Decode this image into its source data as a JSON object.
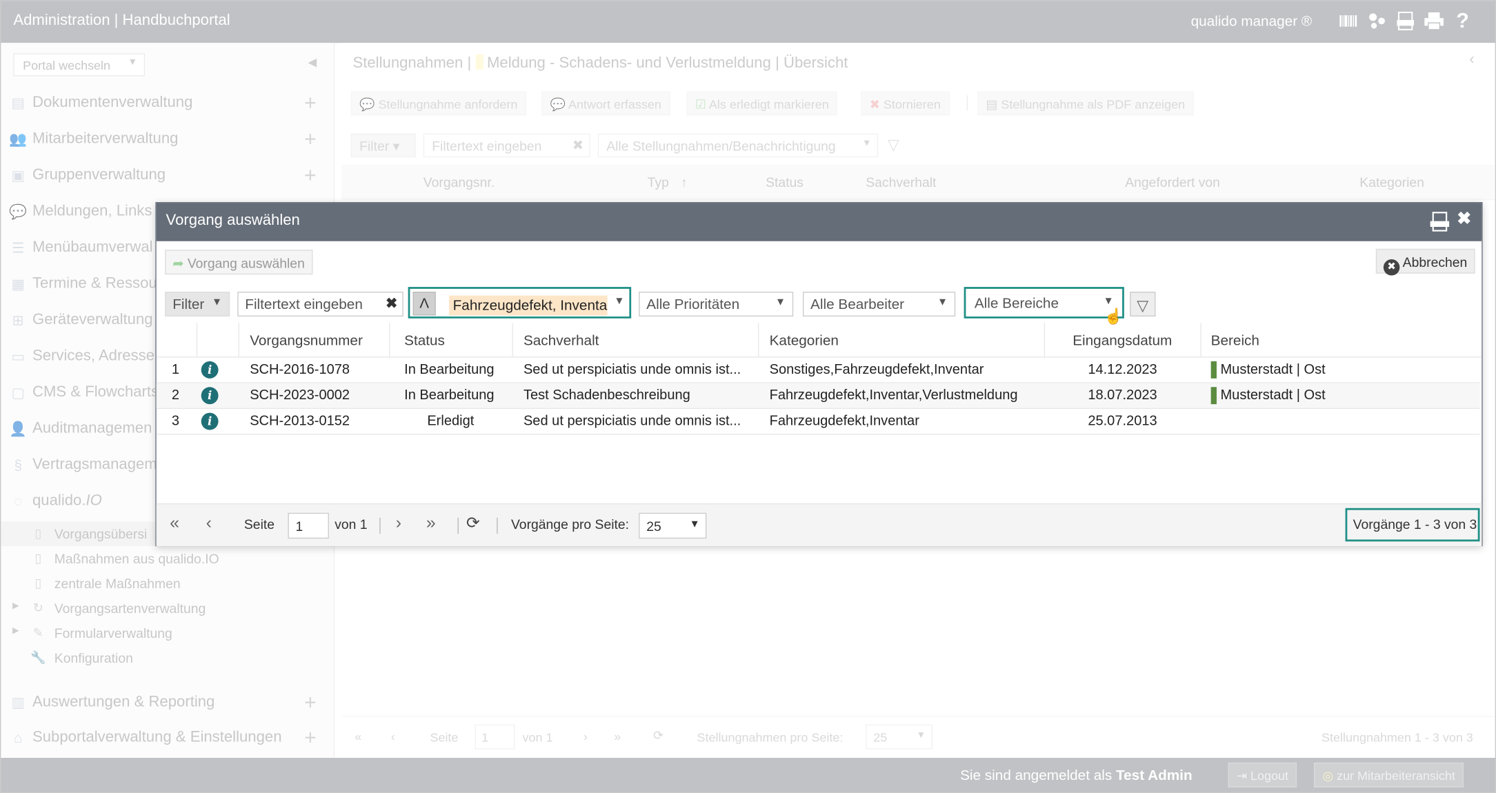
{
  "topbar": {
    "title": "Administration | Handbuchportal",
    "brand": "qualido manager ®",
    "icons": [
      "barcode-icon",
      "network-icon",
      "xls-icon",
      "print-icon",
      "help-icon"
    ]
  },
  "sidebar": {
    "portal_select": "Portal wechseln",
    "items": [
      {
        "label": "Dokumentenverwaltung",
        "icon": "documents-icon",
        "plus": "+"
      },
      {
        "label": "Mitarbeiterverwaltung",
        "icon": "users-icon",
        "plus": "+"
      },
      {
        "label": "Gruppenverwaltung",
        "icon": "groups-icon",
        "plus": "+"
      },
      {
        "label": "Meldungen, Links",
        "icon": "chat-icon"
      },
      {
        "label": "Menübaumverwal",
        "icon": "list-icon"
      },
      {
        "label": "Termine & Ressou",
        "icon": "calendar-icon"
      },
      {
        "label": "Geräteverwaltung",
        "icon": "device-icon"
      },
      {
        "label": "Services, Adressen",
        "icon": "address-icon"
      },
      {
        "label": "CMS & Flowcharts",
        "icon": "cms-icon"
      },
      {
        "label": "Auditmanagemen",
        "icon": "audit-icon"
      },
      {
        "label": "Vertragsmanagem",
        "icon": "paragraph-icon"
      },
      {
        "label": "qualido.",
        "label_em": "IO",
        "icon": "qualido-icon"
      }
    ],
    "subitems": [
      {
        "label": "Vorgangsübersi",
        "icon": "doc-icon"
      },
      {
        "label": "Maßnahmen aus qualido.IO",
        "icon": "doc-icon"
      },
      {
        "label": "zentrale Maßnahmen",
        "icon": "doc-icon"
      },
      {
        "label": "Vorgangsartenverwaltung",
        "icon": "cycle-icon",
        "expandable": true
      },
      {
        "label": "Formularverwaltung",
        "icon": "form-icon",
        "expandable": true
      },
      {
        "label": "Konfiguration",
        "icon": "wrench-icon"
      }
    ],
    "bottom_items": [
      {
        "label": "Auswertungen & Reporting",
        "icon": "chart-icon",
        "plus": "+"
      },
      {
        "label": "Subportalverwaltung & Einstellungen",
        "icon": "home-icon",
        "plus": "+"
      }
    ]
  },
  "main": {
    "breadcrumb": {
      "part1": "Stellungnahmen",
      "sep": "|",
      "part2": "Meldung - Schadens- und Verlustmeldung",
      "sep2": "|",
      "part3": "Übersicht"
    },
    "toolbar": [
      "Stellungnahme anfordern",
      "Antwort erfassen",
      "Als erledigt markieren",
      "Stornieren",
      "Stellungnahme als PDF anzeigen"
    ],
    "filter_label": "Filter",
    "filter_text": "Filtertext eingeben",
    "filter_select": "Alle Stellungnahmen/Benachrichtigung",
    "columns": [
      "Vorgangsnr.",
      "Typ",
      "Status",
      "Sachverhalt",
      "Angefordert von",
      "Kategorien"
    ],
    "pager": {
      "page_label": "Seite",
      "page": "1",
      "of": "von 1",
      "per_page_label": "Stellungnahmen pro Seite:",
      "per_page": "25",
      "summary": "Stellungnahmen 1 - 3 von 3"
    }
  },
  "bottombar": {
    "logged_in_prefix": "Sie sind angemeldet als",
    "user": "Test Admin",
    "logout": "Logout",
    "employee_view": "zur Mitarbeiteransicht"
  },
  "dialog": {
    "title": "Vorgang auswählen",
    "select_button": "Vorgang auswählen",
    "cancel_button": "Abbrechen",
    "filter_label": "Filter",
    "filter_text_placeholder": "Filtertext eingeben",
    "category_filter": "Fahrzeugdefekt, Inventa",
    "priority_filter": "Alle Prioritäten",
    "assignee_filter": "Alle Bearbeiter",
    "area_filter": "Alle Bereiche",
    "columns": [
      "Vorgangsnummer",
      "Status",
      "Sachverhalt",
      "Kategorien",
      "Eingangsdatum",
      "Bereich"
    ],
    "rows": [
      {
        "n": "1",
        "id": "SCH-2016-1078",
        "status": "In Bearbeitung",
        "sachverhalt": "Sed ut perspiciatis unde omnis ist...",
        "kategorien": "Sonstiges,Fahrzeugdefekt,Inventar",
        "datum": "14.12.2023",
        "bereich": "Musterstadt | Ost",
        "bar_color": "#5b8c3f"
      },
      {
        "n": "2",
        "id": "SCH-2023-0002",
        "status": "In Bearbeitung",
        "sachverhalt": "Test Schadenbeschreibung",
        "kategorien": "Fahrzeugdefekt,Inventar,Verlustmeldung",
        "datum": "18.07.2023",
        "bereich": "Musterstadt | Ost",
        "bar_color": "#5b8c3f"
      },
      {
        "n": "3",
        "id": "SCH-2013-0152",
        "status": "Erledigt",
        "sachverhalt": "Sed ut perspiciatis unde omnis ist...",
        "kategorien": "Fahrzeugdefekt,Inventar",
        "datum": "25.07.2013",
        "bereich": ""
      }
    ],
    "pager": {
      "page_label": "Seite",
      "page": "1",
      "of": "von 1",
      "per_page_label": "Vorgänge pro Seite:",
      "per_page": "25",
      "summary": "Vorgänge 1 - 3 von 3"
    }
  },
  "colors": {
    "topbar": "#8c9196",
    "dialog_header": "#656d78",
    "highlight": "#1f8f86",
    "info": "#1f6f76",
    "category_chip": "#fde6c8"
  }
}
